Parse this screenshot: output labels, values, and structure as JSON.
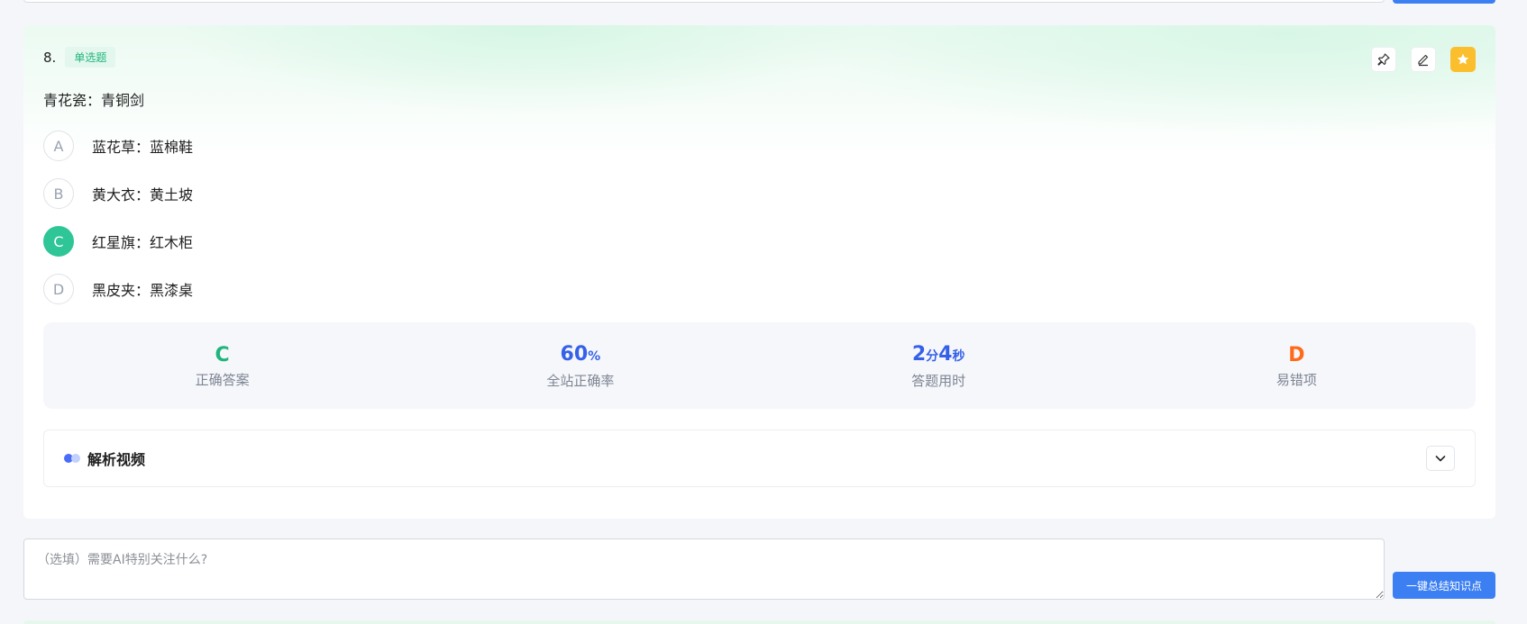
{
  "question": {
    "number": "8.",
    "type_badge": "单选题",
    "stem": "青花瓷：青铜剑",
    "options": [
      {
        "letter": "A",
        "text": "蓝花草：蓝棉鞋",
        "selected": false
      },
      {
        "letter": "B",
        "text": "黄大衣：黄土坡",
        "selected": false
      },
      {
        "letter": "C",
        "text": "红星旗：红木柜",
        "selected": true
      },
      {
        "letter": "D",
        "text": "黑皮夹：黑漆桌",
        "selected": false
      }
    ]
  },
  "tools": {
    "pin_icon": "pin-icon",
    "edit_icon": "edit-icon",
    "favorite_icon": "star-icon"
  },
  "stats": {
    "correct_answer": {
      "value": "C",
      "label": "正确答案"
    },
    "site_accuracy": {
      "value": "60",
      "unit": "%",
      "label": "全站正确率"
    },
    "time_spent": {
      "minutes": "2",
      "minutes_unit": "分",
      "seconds": "4",
      "seconds_unit": "秒",
      "label": "答题用时"
    },
    "common_wrong": {
      "value": "D",
      "label": "易错项"
    }
  },
  "analysis": {
    "title": "解析视频"
  },
  "note": {
    "placeholder": "（选填）需要AI特别关注什么?",
    "value": ""
  },
  "summary_button": "一键总结知识点",
  "colors": {
    "accent_green": "#2ec597",
    "accent_blue": "#3461e8",
    "accent_orange": "#ff6a1a",
    "button_blue": "#3b7ff2",
    "favorite_yellow": "#fbbf2d"
  }
}
